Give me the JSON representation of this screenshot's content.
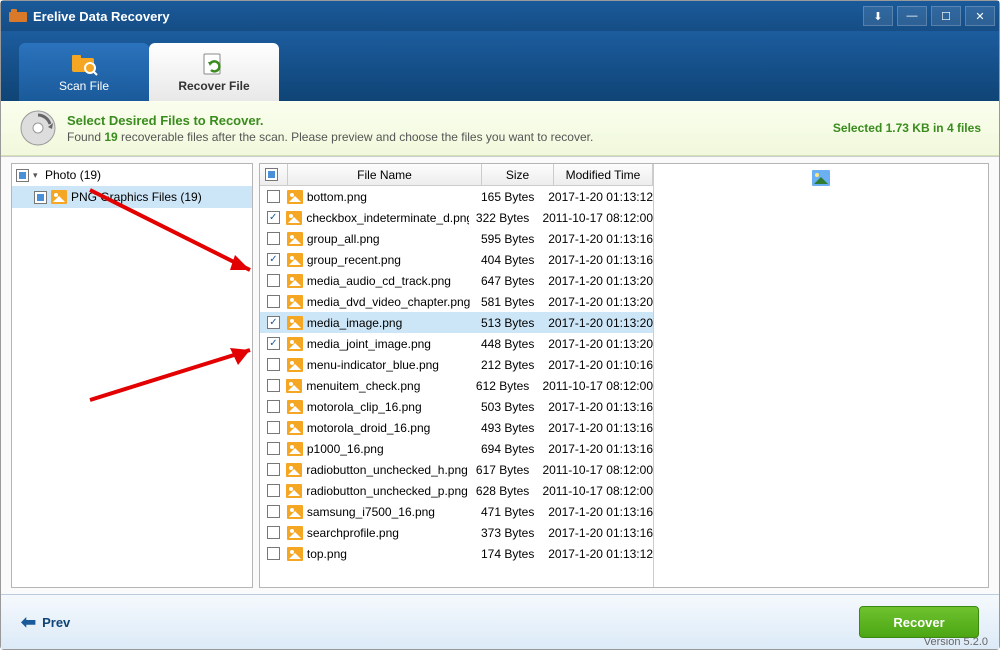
{
  "app": {
    "title": "Erelive Data Recovery"
  },
  "tabs": {
    "scan": "Scan File",
    "recover": "Recover File"
  },
  "banner": {
    "heading": "Select Desired Files to Recover.",
    "prefix": "Found ",
    "count": "19",
    "suffix": " recoverable files after the scan. Please preview and choose the files you want to recover.",
    "status": "Selected 1.73 KB in 4 files"
  },
  "tree": {
    "root": "Photo (19)",
    "child": "PNG Graphics Files (19)"
  },
  "columns": {
    "name": "File Name",
    "size": "Size",
    "time": "Modified Time"
  },
  "files": [
    {
      "name": "bottom.png",
      "size": "165 Bytes",
      "time": "2017-1-20 01:13:12",
      "checked": false,
      "selected": false
    },
    {
      "name": "checkbox_indeterminate_d.png",
      "size": "322 Bytes",
      "time": "2011-10-17 08:12:00",
      "checked": true,
      "selected": false
    },
    {
      "name": "group_all.png",
      "size": "595 Bytes",
      "time": "2017-1-20 01:13:16",
      "checked": false,
      "selected": false
    },
    {
      "name": "group_recent.png",
      "size": "404 Bytes",
      "time": "2017-1-20 01:13:16",
      "checked": true,
      "selected": false
    },
    {
      "name": "media_audio_cd_track.png",
      "size": "647 Bytes",
      "time": "2017-1-20 01:13:20",
      "checked": false,
      "selected": false
    },
    {
      "name": "media_dvd_video_chapter.png",
      "size": "581 Bytes",
      "time": "2017-1-20 01:13:20",
      "checked": false,
      "selected": false
    },
    {
      "name": "media_image.png",
      "size": "513 Bytes",
      "time": "2017-1-20 01:13:20",
      "checked": true,
      "selected": true
    },
    {
      "name": "media_joint_image.png",
      "size": "448 Bytes",
      "time": "2017-1-20 01:13:20",
      "checked": true,
      "selected": false
    },
    {
      "name": "menu-indicator_blue.png",
      "size": "212 Bytes",
      "time": "2017-1-20 01:10:16",
      "checked": false,
      "selected": false
    },
    {
      "name": "menuitem_check.png",
      "size": "612 Bytes",
      "time": "2011-10-17 08:12:00",
      "checked": false,
      "selected": false
    },
    {
      "name": "motorola_clip_16.png",
      "size": "503 Bytes",
      "time": "2017-1-20 01:13:16",
      "checked": false,
      "selected": false
    },
    {
      "name": "motorola_droid_16.png",
      "size": "493 Bytes",
      "time": "2017-1-20 01:13:16",
      "checked": false,
      "selected": false
    },
    {
      "name": "p1000_16.png",
      "size": "694 Bytes",
      "time": "2017-1-20 01:13:16",
      "checked": false,
      "selected": false
    },
    {
      "name": "radiobutton_unchecked_h.png",
      "size": "617 Bytes",
      "time": "2011-10-17 08:12:00",
      "checked": false,
      "selected": false
    },
    {
      "name": "radiobutton_unchecked_p.png",
      "size": "628 Bytes",
      "time": "2011-10-17 08:12:00",
      "checked": false,
      "selected": false
    },
    {
      "name": "samsung_i7500_16.png",
      "size": "471 Bytes",
      "time": "2017-1-20 01:13:16",
      "checked": false,
      "selected": false
    },
    {
      "name": "searchprofile.png",
      "size": "373 Bytes",
      "time": "2017-1-20 01:13:16",
      "checked": false,
      "selected": false
    },
    {
      "name": "top.png",
      "size": "174 Bytes",
      "time": "2017-1-20 01:13:12",
      "checked": false,
      "selected": false
    }
  ],
  "footer": {
    "prev": "Prev",
    "recover": "Recover",
    "version": "Version 5.2.0"
  }
}
